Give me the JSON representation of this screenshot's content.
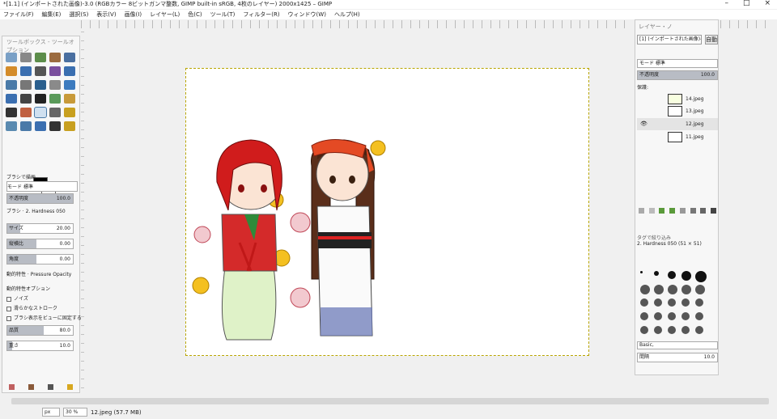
{
  "window": {
    "title": "*[1.1] (インポートされた画像)-3.0 (RGBカラー 8ビットガンマ整数, GIMP built-in sRGB, 4枚のレイヤー) 2000x1425 – GIMP",
    "controls": [
      "–",
      "□",
      "×"
    ]
  },
  "menubar": [
    "ファイル(F)",
    "編集(E)",
    "選択(S)",
    "表示(V)",
    "画像(I)",
    "レイヤー(L)",
    "色(C)",
    "ツール(T)",
    "フィルター(R)",
    "ウィンドウ(W)",
    "ヘルプ(H)"
  ],
  "toolbox": {
    "header": "ツールボックス - ツールオプション",
    "tool_colors": [
      "#7aa0c6",
      "#888",
      "#5c8d4a",
      "#9b6b3f",
      "#4a6fa0",
      "#d48c2a",
      "#3b6fb0",
      "#555",
      "#7a4f9e",
      "#3b6fb0",
      "#4a7aa8",
      "#777",
      "#2a5f8e",
      "#8a8a8a",
      "#3d7bbf",
      "#3b6fb0",
      "#444",
      "#222",
      "#5a9a5a",
      "#c89a3a",
      "#333",
      "#c06040",
      "#4a7aa8",
      "#666",
      "#c8a020",
      "#5a8ab0",
      "#4a7aa8",
      "#3b6fb0",
      "#333",
      "#c8a020"
    ],
    "options_title": "ブラシで描画",
    "mode_label": "モード",
    "mode_value": "標準",
    "opacity_label": "不透明度",
    "opacity_value": "100.0",
    "brush_label": "ブラシ",
    "brush_value": "2. Hardness 050",
    "size_label": "サイズ",
    "size_value": "20.00",
    "aspect_label": "縦横比",
    "aspect_value": "0.00",
    "angle_label": "角度",
    "angle_value": "0.00",
    "dynamics_label": "動的特性",
    "dynamics_value": "Pressure Opacity",
    "dynamics_options": "動的特性オプション",
    "jitter": "ノイズ",
    "smooth": "滑らかなストローク",
    "lock_brush": "ブラシ表示をビューに固定する",
    "quality_label": "品質",
    "quality_value": "80.0",
    "weight_label": "重さ",
    "weight_value": "10.0"
  },
  "dock": {
    "tabs_label": "レイヤー・ノ",
    "image_select": "[1] (インポートされた画像)-3",
    "auto_button": "自動",
    "mode_label": "モード 標準",
    "opacity_label": "不透明度",
    "opacity_value": "100.0",
    "lock_label": "保護:",
    "layers": [
      {
        "name": "14.jpeg",
        "visible": false
      },
      {
        "name": "13.jpeg",
        "visible": false
      },
      {
        "name": "12.jpeg",
        "visible": true
      },
      {
        "name": "11.jpeg",
        "visible": false
      }
    ],
    "brushes_title": "2. Hardness 050 (51 × 51)",
    "brush_filter": "タグで絞り込み",
    "brush_tags": "Basic,",
    "spacing_label": "間隔",
    "spacing_value": "10.0"
  },
  "statusbar": {
    "unit": "px",
    "zoom": "30 %",
    "file_info": "12.jpeg (57.7 MB)"
  }
}
